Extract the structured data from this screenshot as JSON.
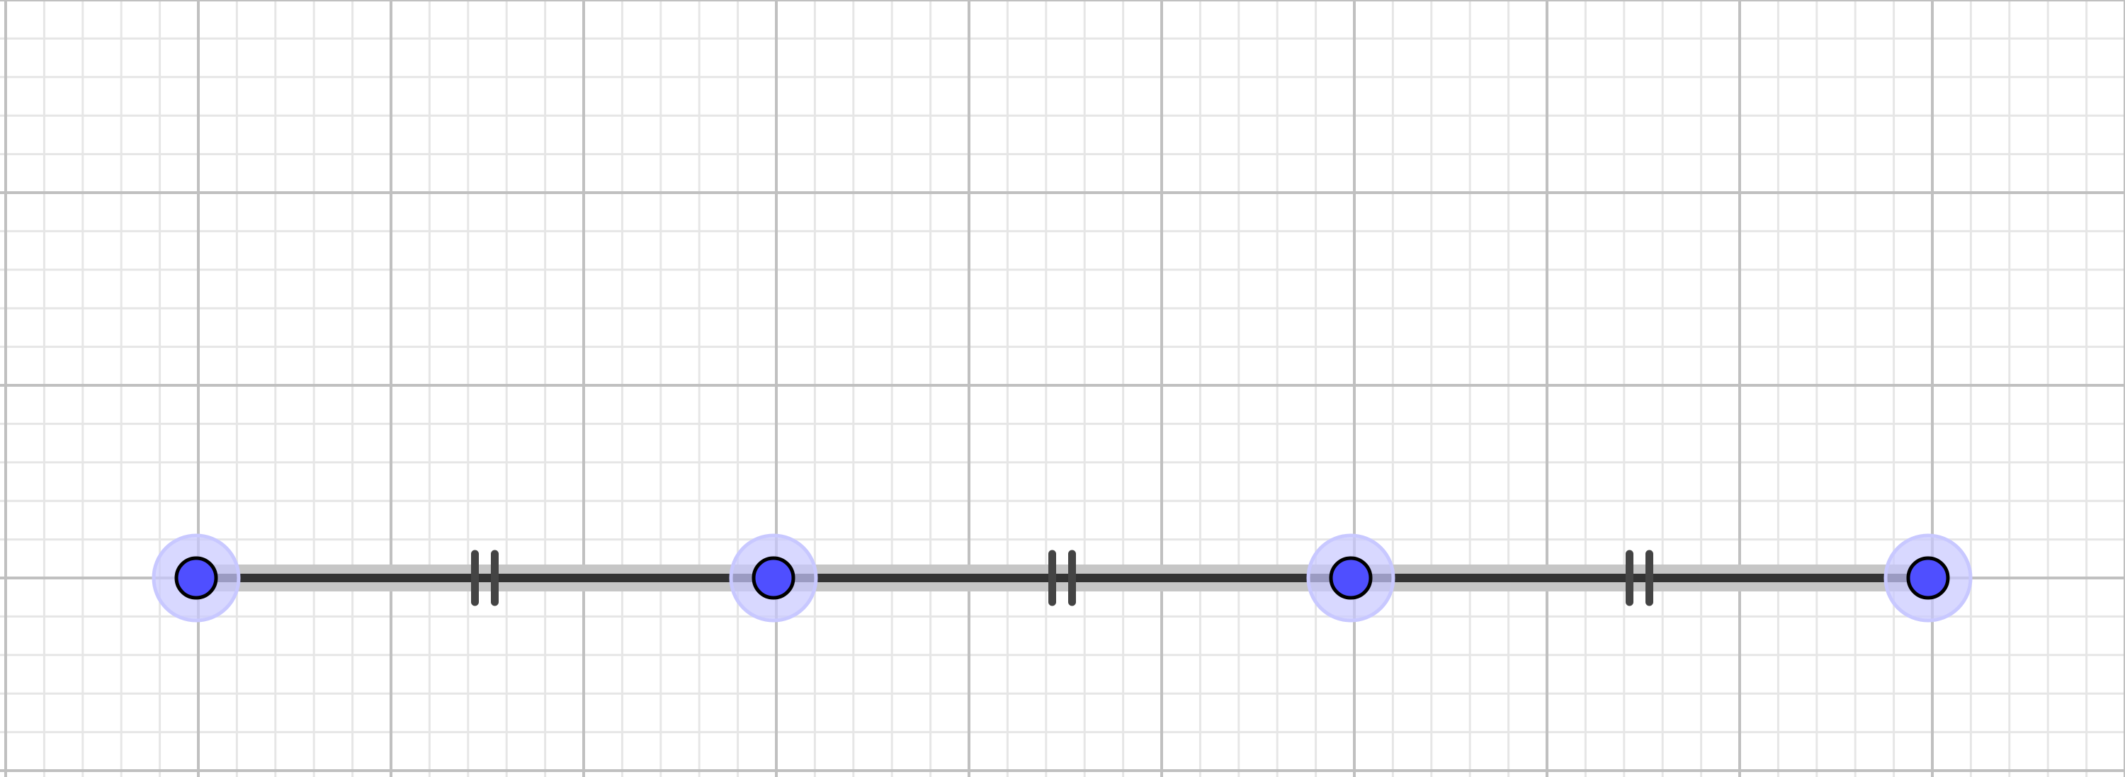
{
  "canvas": {
    "background": "#ffffff",
    "grid_visible": true,
    "minor_grid_color": "#e6e6e6",
    "major_grid_color": "#c0c0c0",
    "minor_subdivisions": 5
  },
  "segments": {
    "color": "#333333",
    "highlight_color": "#c6c6c6",
    "tick_mark_color": "#444444",
    "tick_mark_style": "double",
    "items": [
      {
        "from": "p1",
        "to": "p2"
      },
      {
        "from": "p2",
        "to": "p3"
      },
      {
        "from": "p3",
        "to": "p4"
      }
    ]
  },
  "points": {
    "fill_color": "#4f4fff",
    "halo_color": "#c8c8ff",
    "outline_color": "#000000",
    "items": [
      {
        "id": "p1"
      },
      {
        "id": "p2"
      },
      {
        "id": "p3"
      },
      {
        "id": "p4"
      }
    ]
  }
}
